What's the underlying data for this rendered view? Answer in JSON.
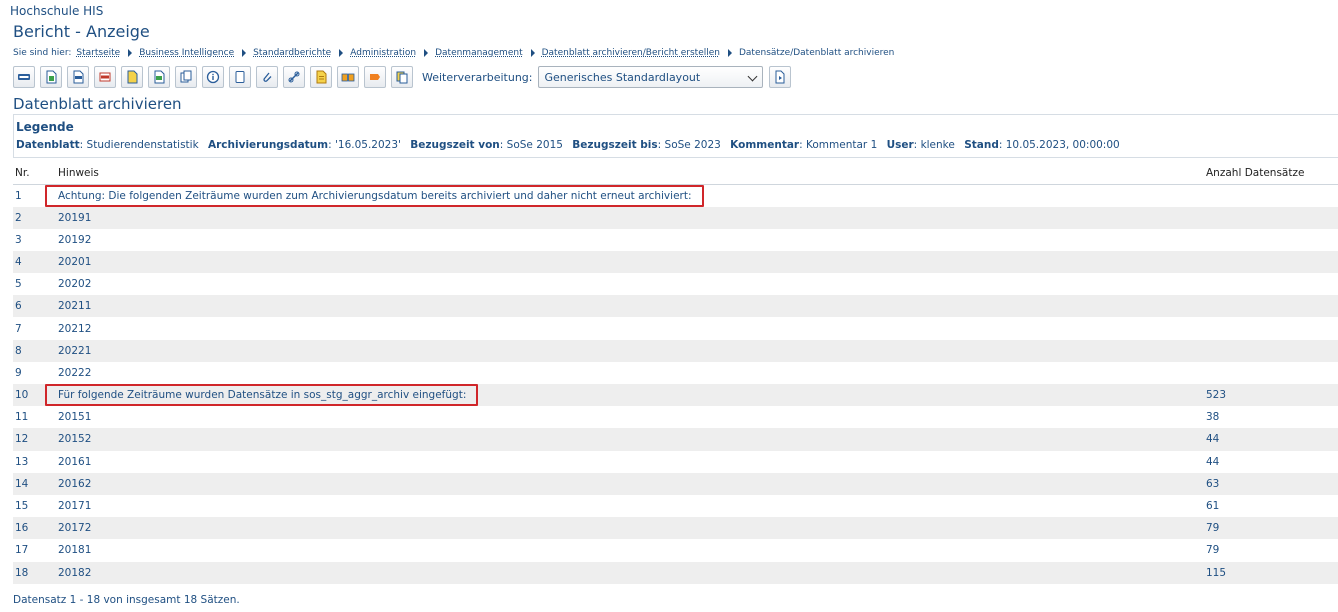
{
  "header": {
    "org": "Hochschule HIS",
    "title": "Bericht - Anzeige"
  },
  "breadcrumb": {
    "lead": "Sie sind hier:",
    "items": [
      "Startseite",
      "Business Intelligence",
      "Standardberichte",
      "Administration",
      "Datenmanagement",
      "Datenblatt archivieren/Bericht erstellen"
    ],
    "current": "Datensätze/Datenblatt archivieren"
  },
  "toolbar": {
    "icons": [
      "html-export-icon",
      "excel-export-icon",
      "xml-export-icon",
      "pdf-export-icon",
      "document-icon",
      "csv-export-icon",
      "copy-icon",
      "info-icon",
      "notes-icon",
      "attachment-icon",
      "link-icon",
      "report-icon",
      "compare-icon",
      "bookmark-icon",
      "table-copy-icon"
    ],
    "weiterverarbeitung_label": "Weiterverarbeitung:",
    "layout_selected": "Generisches Standardlayout",
    "apply_icon": "apply-icon"
  },
  "sheet": {
    "title": "Datenblatt archivieren"
  },
  "legend": {
    "title": "Legende",
    "fields": [
      {
        "label": "Datenblatt",
        "value": "Studierendenstatistik"
      },
      {
        "label": "Archivierungsdatum",
        "value": "'16.05.2023'"
      },
      {
        "label": "Bezugszeit von",
        "value": "SoSe 2015"
      },
      {
        "label": "Bezugszeit bis",
        "value": "SoSe 2023"
      },
      {
        "label": "Kommentar",
        "value": "Kommentar 1"
      },
      {
        "label": "User",
        "value": "klenke"
      },
      {
        "label": "Stand",
        "value": "10.05.2023, 00:00:00"
      }
    ]
  },
  "table": {
    "columns": [
      "Nr.",
      "Hinweis",
      "Anzahl Datensätze"
    ],
    "rows": [
      {
        "nr": "1",
        "hint": "Achtung: Die folgenden Zeiträume wurden zum Archivierungsdatum bereits archiviert und daher nicht erneut archiviert:",
        "count": "",
        "highlight": true
      },
      {
        "nr": "2",
        "hint": "20191",
        "count": ""
      },
      {
        "nr": "3",
        "hint": "20192",
        "count": ""
      },
      {
        "nr": "4",
        "hint": "20201",
        "count": ""
      },
      {
        "nr": "5",
        "hint": "20202",
        "count": ""
      },
      {
        "nr": "6",
        "hint": "20211",
        "count": ""
      },
      {
        "nr": "7",
        "hint": "20212",
        "count": ""
      },
      {
        "nr": "8",
        "hint": "20221",
        "count": ""
      },
      {
        "nr": "9",
        "hint": "20222",
        "count": ""
      },
      {
        "nr": "10",
        "hint": "Für folgende Zeiträume wurden Datensätze in sos_stg_aggr_archiv eingefügt:",
        "count": "523",
        "highlight": true
      },
      {
        "nr": "11",
        "hint": "20151",
        "count": "38"
      },
      {
        "nr": "12",
        "hint": "20152",
        "count": "44"
      },
      {
        "nr": "13",
        "hint": "20161",
        "count": "44"
      },
      {
        "nr": "14",
        "hint": "20162",
        "count": "63"
      },
      {
        "nr": "15",
        "hint": "20171",
        "count": "61"
      },
      {
        "nr": "16",
        "hint": "20172",
        "count": "79"
      },
      {
        "nr": "17",
        "hint": "20181",
        "count": "79"
      },
      {
        "nr": "18",
        "hint": "20182",
        "count": "115"
      }
    ]
  },
  "footer": {
    "text": "Datensatz 1 - 18 von insgesamt 18 Sätzen."
  },
  "colors": {
    "text": "#1f4f82",
    "highlight_border": "#d0262a",
    "row_alt": "#eeeeee"
  }
}
